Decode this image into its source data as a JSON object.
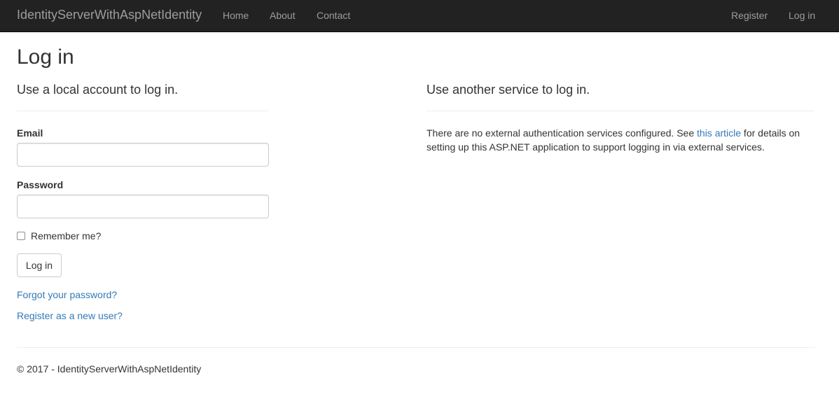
{
  "navbar": {
    "brand": "IdentityServerWithAspNetIdentity",
    "left_links": [
      "Home",
      "About",
      "Contact"
    ],
    "right_links": [
      "Register",
      "Log in"
    ],
    "background": "#222222",
    "link_color": "#9d9d9d"
  },
  "page": {
    "title": "Log in"
  },
  "local_login": {
    "heading": "Use a local account to log in.",
    "email_label": "Email",
    "email_value": "",
    "password_label": "Password",
    "password_value": "",
    "remember_label": "Remember me?",
    "remember_checked": false,
    "submit_label": "Log in",
    "forgot_link": "Forgot your password?",
    "register_link": "Register as a new user?"
  },
  "external_login": {
    "heading": "Use another service to log in.",
    "text_before": "There are no external authentication services configured. See ",
    "link_text": "this article",
    "text_after": " for details on setting up this ASP.NET application to support logging in via external services."
  },
  "footer": {
    "text": "© 2017 - IdentityServerWithAspNetIdentity"
  },
  "colors": {
    "link": "#337ab7",
    "text": "#333333",
    "border": "#cccccc"
  }
}
